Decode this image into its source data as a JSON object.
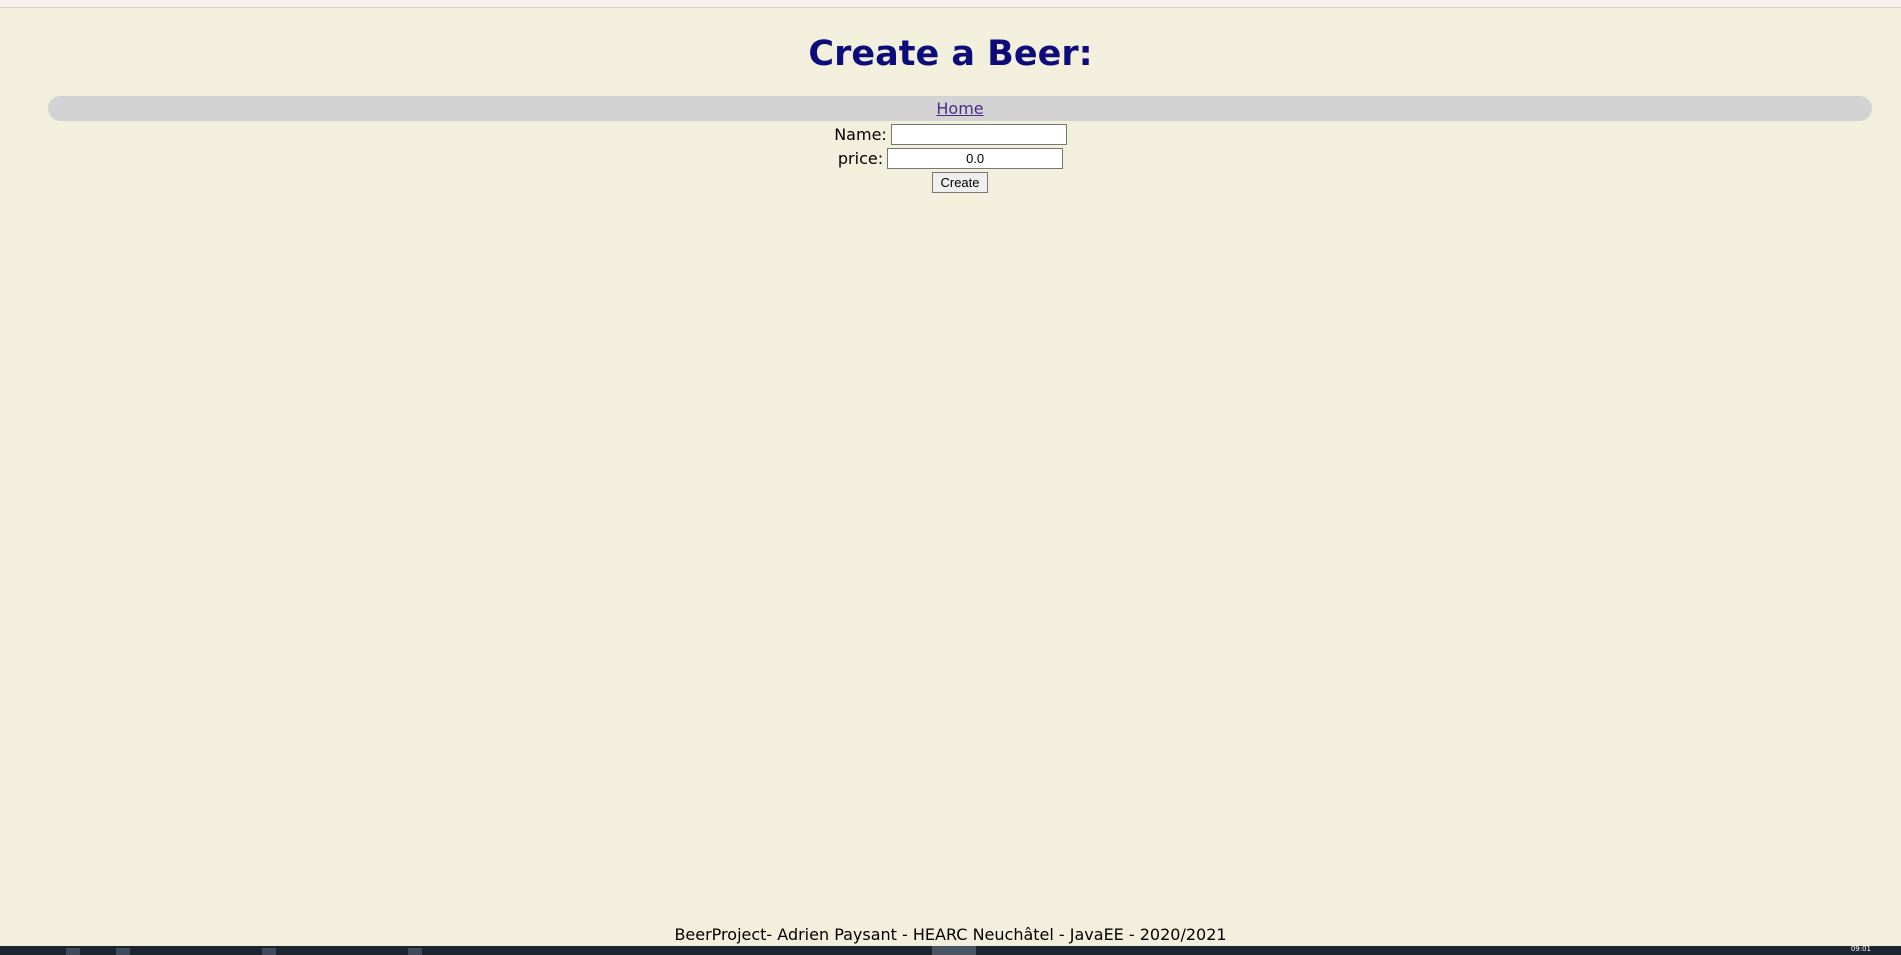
{
  "page": {
    "title": "Create a Beer:"
  },
  "nav": {
    "home_label": "Home"
  },
  "form": {
    "name_label": "Name:",
    "name_value": "",
    "price_label": "price:",
    "price_value": "0.0",
    "create_label": "Create"
  },
  "footer": {
    "text": "BeerProject- Adrien Paysant - HEARC Neuchâtel - JavaEE - 2020/2021"
  },
  "taskbar": {
    "clock": "09:01"
  },
  "colors": {
    "background": "#f2efdc",
    "title": "#0c0c7a",
    "nav_bar": "#d3d3d3",
    "link": "#4b2a8a"
  }
}
